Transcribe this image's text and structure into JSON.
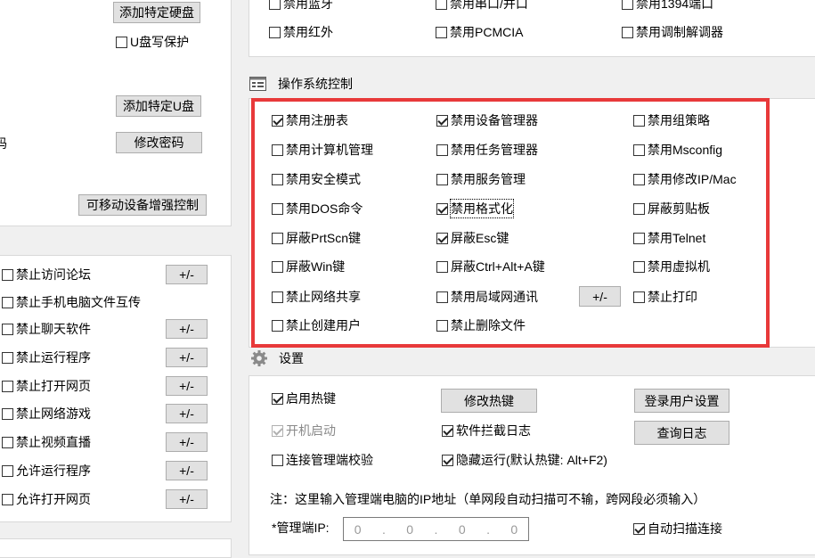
{
  "left": {
    "add_disk_btn": "添加特定硬盘",
    "usb_write_protect": {
      "label": "U盘写保护",
      "checked": false
    },
    "add_usb_btn": "添加特定U盘",
    "change_pwd_btn": "修改密码",
    "partial_label": "码",
    "removable_btn": "可移动设备增强控制",
    "list": [
      {
        "label": "禁止访问论坛",
        "checked": false,
        "has_btn": true
      },
      {
        "label": "禁止手机电脑文件互传",
        "checked": false,
        "has_btn": false
      },
      {
        "label": "禁止聊天软件",
        "checked": false,
        "has_btn": true
      },
      {
        "label": "禁止运行程序",
        "checked": false,
        "has_btn": true
      },
      {
        "label": "禁止打开网页",
        "checked": false,
        "has_btn": true
      },
      {
        "label": "禁止网络游戏",
        "checked": false,
        "has_btn": true
      },
      {
        "label": "禁止视频直播",
        "checked": false,
        "has_btn": true
      },
      {
        "label": "允许运行程序",
        "checked": false,
        "has_btn": true
      },
      {
        "label": "允许打开网页",
        "checked": false,
        "has_btn": true
      }
    ],
    "plusminus": "+/-"
  },
  "devices": {
    "row1": [
      "禁用蓝牙",
      "禁用串口/并口",
      "禁用1394端口"
    ],
    "row2": [
      "禁用红外",
      "禁用PCMCIA",
      "禁用调制解调器"
    ]
  },
  "os_section": {
    "title": "操作系统控制",
    "col1": [
      {
        "label": "禁用注册表",
        "checked": true
      },
      {
        "label": "禁用计算机管理",
        "checked": false
      },
      {
        "label": "禁用安全模式",
        "checked": false
      },
      {
        "label": "禁用DOS命令",
        "checked": false
      },
      {
        "label": "屏蔽PrtScn键",
        "checked": false
      },
      {
        "label": "屏蔽Win键",
        "checked": false
      },
      {
        "label": "禁止网络共享",
        "checked": false
      },
      {
        "label": "禁止创建用户",
        "checked": false
      }
    ],
    "col2": [
      {
        "label": "禁用设备管理器",
        "checked": true
      },
      {
        "label": "禁用任务管理器",
        "checked": false
      },
      {
        "label": "禁用服务管理",
        "checked": false
      },
      {
        "label": "禁用格式化",
        "checked": true
      },
      {
        "label": "屏蔽Esc键",
        "checked": true
      },
      {
        "label": "屏蔽Ctrl+Alt+A键",
        "checked": false
      },
      {
        "label": "禁用局域网通讯",
        "checked": false
      },
      {
        "label": "禁止删除文件",
        "checked": false
      }
    ],
    "col3": [
      {
        "label": "禁用组策略",
        "checked": false
      },
      {
        "label": "禁用Msconfig",
        "checked": false
      },
      {
        "label": "禁用修改IP/Mac",
        "checked": false
      },
      {
        "label": "屏蔽剪贴板",
        "checked": false
      },
      {
        "label": "禁用Telnet",
        "checked": false
      },
      {
        "label": "禁用虚拟机",
        "checked": false
      },
      {
        "label": "禁止打印",
        "checked": false
      }
    ],
    "lan_btn": "+/-"
  },
  "settings": {
    "title": "设置",
    "hotkey": {
      "label": "启用热键",
      "checked": true
    },
    "autostart": {
      "label": "开机启动",
      "checked": true
    },
    "verify": {
      "label": "连接管理端校验",
      "checked": false
    },
    "intercept_log": {
      "label": "软件拦截日志",
      "checked": true
    },
    "hidden_run": {
      "label": "隐藏运行(默认热键: Alt+F2)",
      "checked": true
    },
    "modify_hotkey_btn": "修改热键",
    "login_user_btn": "登录用户设置",
    "query_log_btn": "查询日志",
    "note": "注：这里输入管理端电脑的IP地址（单网段自动扫描可不输，跨网段必须输入）",
    "ip_label": "*管理端IP:",
    "ip_octets": [
      "0",
      "0",
      "0",
      "0"
    ],
    "auto_scan": {
      "label": "自动扫描连接",
      "checked": true
    }
  },
  "colors": {
    "highlight": "#e8393a"
  }
}
